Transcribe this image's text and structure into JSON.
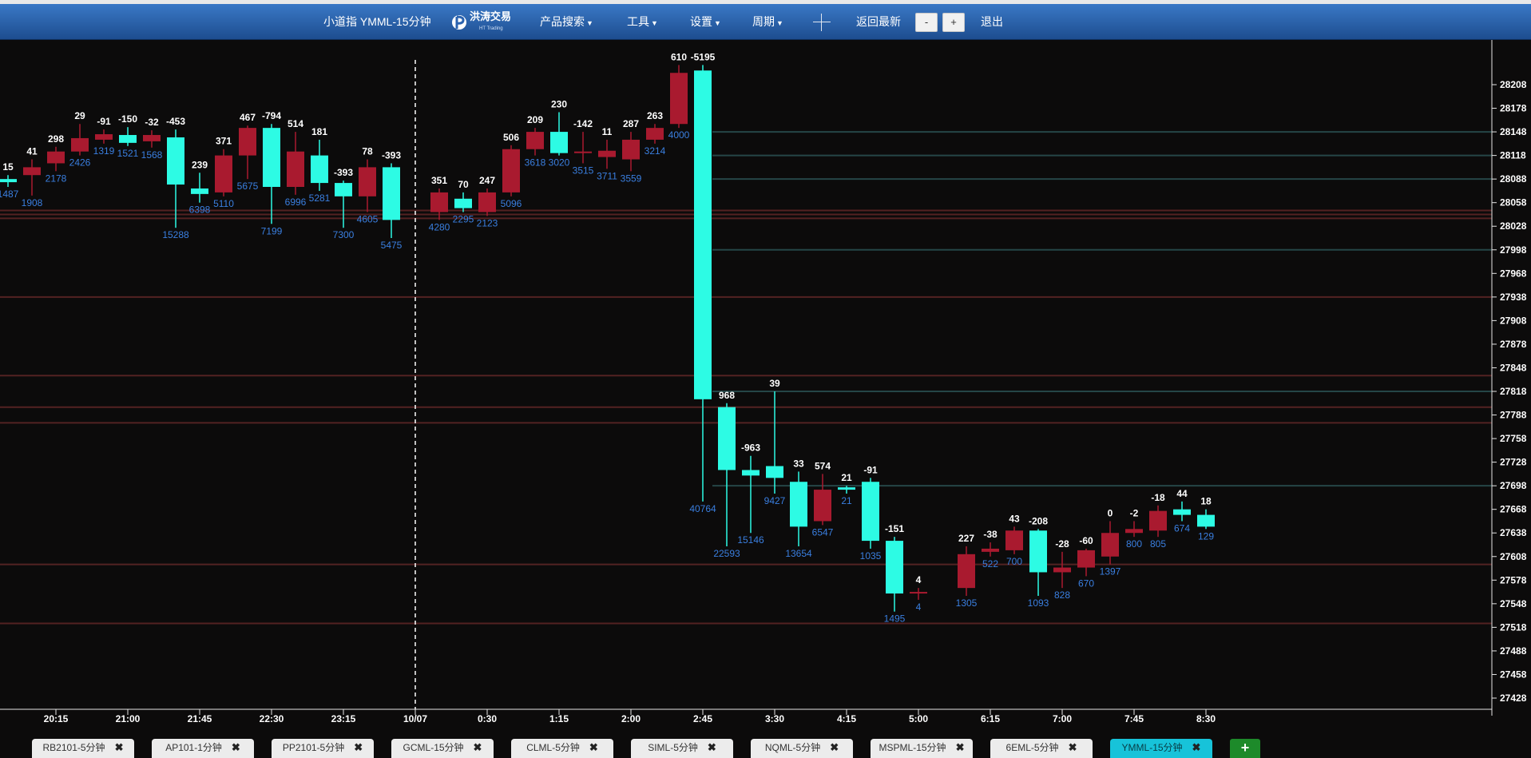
{
  "header": {
    "title": "小道指 YMML-15分钟",
    "logo_text": "洪涛交易",
    "logo_subtext": "HT Trading",
    "menu": [
      "产品搜索",
      "工具",
      "设置",
      "周期"
    ],
    "back_latest": "返回最新",
    "zoom_out": "-",
    "zoom_in": "+",
    "exit": "退出"
  },
  "colors": {
    "up": "#2dfbe4",
    "down": "#a91a2f",
    "accent_nav": "#2c67b7",
    "vol_label": "#3a7fe0"
  },
  "tabs": [
    {
      "label": "RB2101-5分钟",
      "active": false
    },
    {
      "label": "AP101-1分钟",
      "active": false
    },
    {
      "label": "PP2101-5分钟",
      "active": false
    },
    {
      "label": "GCML-15分钟",
      "active": false
    },
    {
      "label": "CLML-5分钟",
      "active": false
    },
    {
      "label": "SIML-5分钟",
      "active": false
    },
    {
      "label": "NQML-5分钟",
      "active": false
    },
    {
      "label": "MSPML-15分钟",
      "active": false
    },
    {
      "label": "6EML-5分钟",
      "active": false
    },
    {
      "label": "YMML-15分钟",
      "active": true
    }
  ],
  "tab_close": "✖",
  "add_tab": "+",
  "chart_data": {
    "type": "candlestick",
    "x_ticks": [
      "20:15",
      "21:00",
      "21:45",
      "22:30",
      "23:15",
      "10/07",
      "0:30",
      "1:15",
      "2:00",
      "2:45",
      "3:30",
      "4:15",
      "5:00",
      "6:15",
      "7:00",
      "7:45",
      "8:30"
    ],
    "y_ticks": [
      28208,
      28178,
      28148,
      28118,
      28088,
      28058,
      28028,
      27998,
      27968,
      27938,
      27908,
      27878,
      27848,
      27818,
      27788,
      27758,
      27728,
      27698,
      27668,
      27638,
      27608,
      27578,
      27548,
      27518,
      27488,
      27458,
      27428
    ],
    "ylim": [
      27428,
      28208
    ],
    "session_divider": "10/07",
    "candles": [
      {
        "o": 28088,
        "c": 28084,
        "h": 28093,
        "l": 28078,
        "d": "15",
        "v": "1487"
      },
      {
        "o": 28093,
        "c": 28103,
        "h": 28113,
        "l": 28067,
        "d": "41",
        "v": "1908"
      },
      {
        "o": 28108,
        "c": 28123,
        "h": 28129,
        "l": 28098,
        "d": "298",
        "v": "2178"
      },
      {
        "o": 28123,
        "c": 28140,
        "h": 28158,
        "l": 28118,
        "d": "29",
        "v": "2426"
      },
      {
        "o": 28138,
        "c": 28145,
        "h": 28151,
        "l": 28133,
        "d": "-91",
        "v": "1319"
      },
      {
        "o": 28144,
        "c": 28134,
        "h": 28154,
        "l": 28130,
        "d": "-150",
        "v": "1521"
      },
      {
        "o": 28136,
        "c": 28144,
        "h": 28150,
        "l": 28128,
        "d": "-32",
        "v": "1568"
      },
      {
        "o": 28141,
        "c": 28081,
        "h": 28151,
        "l": 28026,
        "d": "-453",
        "v": "15288"
      },
      {
        "o": 28076,
        "c": 28069,
        "h": 28096,
        "l": 28058,
        "d": "239",
        "v": "6398"
      },
      {
        "o": 28071,
        "c": 28118,
        "h": 28126,
        "l": 28066,
        "d": "371",
        "v": "5110"
      },
      {
        "o": 28118,
        "c": 28153,
        "h": 28156,
        "l": 28088,
        "d": "467",
        "v": "5675"
      },
      {
        "o": 28153,
        "c": 28078,
        "h": 28158,
        "l": 28031,
        "d": "-794",
        "v": "7199"
      },
      {
        "o": 28078,
        "c": 28123,
        "h": 28148,
        "l": 28068,
        "d": "514",
        "v": "6996"
      },
      {
        "o": 28118,
        "c": 28083,
        "h": 28138,
        "l": 28073,
        "d": "181",
        "v": "5281"
      },
      {
        "o": 28083,
        "c": 28066,
        "h": 28086,
        "l": 28026,
        "d": "-393",
        "v": "7300"
      },
      {
        "o": 28066,
        "c": 28103,
        "h": 28113,
        "l": 28046,
        "d": "78",
        "v": "4605"
      },
      {
        "o": 28103,
        "c": 28036,
        "h": 28108,
        "l": 28013,
        "d": "-393",
        "v": "5475"
      },
      {
        "o": 28046,
        "c": 28071,
        "h": 28076,
        "l": 28036,
        "d": "351",
        "v": "4280"
      },
      {
        "o": 28063,
        "c": 28051,
        "h": 28071,
        "l": 28046,
        "d": "70",
        "v": "2295"
      },
      {
        "o": 28046,
        "c": 28071,
        "h": 28076,
        "l": 28041,
        "d": "247",
        "v": "2123"
      },
      {
        "o": 28071,
        "c": 28126,
        "h": 28131,
        "l": 28066,
        "d": "506",
        "v": "5096"
      },
      {
        "o": 28126,
        "c": 28148,
        "h": 28153,
        "l": 28118,
        "d": "209",
        "v": "3618"
      },
      {
        "o": 28148,
        "c": 28121,
        "h": 28173,
        "l": 28118,
        "d": "230",
        "v": "3020"
      },
      {
        "o": 28121,
        "c": 28123,
        "h": 28148,
        "l": 28108,
        "d": "-142",
        "v": "3515"
      },
      {
        "o": 28116,
        "c": 28124,
        "h": 28138,
        "l": 28101,
        "d": "11",
        "v": "3711"
      },
      {
        "o": 28113,
        "c": 28138,
        "h": 28148,
        "l": 28098,
        "d": "287",
        "v": "3559"
      },
      {
        "o": 28138,
        "c": 28153,
        "h": 28158,
        "l": 28133,
        "d": "263",
        "v": "3214"
      },
      {
        "o": 28158,
        "c": 28223,
        "h": 28233,
        "l": 28153,
        "d": "610",
        "v": "4000"
      },
      {
        "o": 28226,
        "c": 27808,
        "h": 28233,
        "l": 27678,
        "d": "-5195",
        "v": "40764"
      },
      {
        "o": 27798,
        "c": 27718,
        "h": 27803,
        "l": 27621,
        "d": "968",
        "v": "22593"
      },
      {
        "o": 27718,
        "c": 27711,
        "h": 27736,
        "l": 27638,
        "d": "-963",
        "v": "15146"
      },
      {
        "o": 27723,
        "c": 27708,
        "h": 27818,
        "l": 27688,
        "d": "39",
        "v": "9427"
      },
      {
        "o": 27703,
        "c": 27646,
        "h": 27716,
        "l": 27621,
        "d": "33",
        "v": "13654"
      },
      {
        "o": 27653,
        "c": 27693,
        "h": 27713,
        "l": 27648,
        "d": "574",
        "v": "6547"
      },
      {
        "o": 27696,
        "c": 27693,
        "h": 27698,
        "l": 27688,
        "d": "21",
        "v": "21"
      },
      {
        "o": 27703,
        "c": 27628,
        "h": 27708,
        "l": 27618,
        "d": "-91",
        "v": "1035"
      },
      {
        "o": 27628,
        "c": 27561,
        "h": 27633,
        "l": 27538,
        "d": "-151",
        "v": "1495"
      },
      {
        "o": 27563,
        "c": 27563,
        "h": 27568,
        "l": 27553,
        "d": "4",
        "v": "4"
      },
      {
        "o": 27568,
        "c": 27611,
        "h": 27621,
        "l": 27558,
        "d": "227",
        "v": "1305"
      },
      {
        "o": 27614,
        "c": 27618,
        "h": 27626,
        "l": 27608,
        "d": "-38",
        "v": "522"
      },
      {
        "o": 27616,
        "c": 27641,
        "h": 27646,
        "l": 27611,
        "d": "43",
        "v": "700"
      },
      {
        "o": 27641,
        "c": 27588,
        "h": 27643,
        "l": 27558,
        "d": "-208",
        "v": "1093"
      },
      {
        "o": 27588,
        "c": 27594,
        "h": 27614,
        "l": 27568,
        "d": "-28",
        "v": "828"
      },
      {
        "o": 27594,
        "c": 27616,
        "h": 27618,
        "l": 27583,
        "d": "-60",
        "v": "670"
      },
      {
        "o": 27608,
        "c": 27638,
        "h": 27653,
        "l": 27598,
        "d": "0",
        "v": "1397"
      },
      {
        "o": 27638,
        "c": 27643,
        "h": 27653,
        "l": 27633,
        "d": "-2",
        "v": "800"
      },
      {
        "o": 27641,
        "c": 27666,
        "h": 27673,
        "l": 27633,
        "d": "-18",
        "v": "805"
      },
      {
        "o": 27668,
        "c": 27661,
        "h": 27678,
        "l": 27653,
        "d": "44",
        "v": "674"
      },
      {
        "o": 27661,
        "c": 27646,
        "h": 27668,
        "l": 27643,
        "d": "18",
        "v": "129"
      }
    ]
  }
}
